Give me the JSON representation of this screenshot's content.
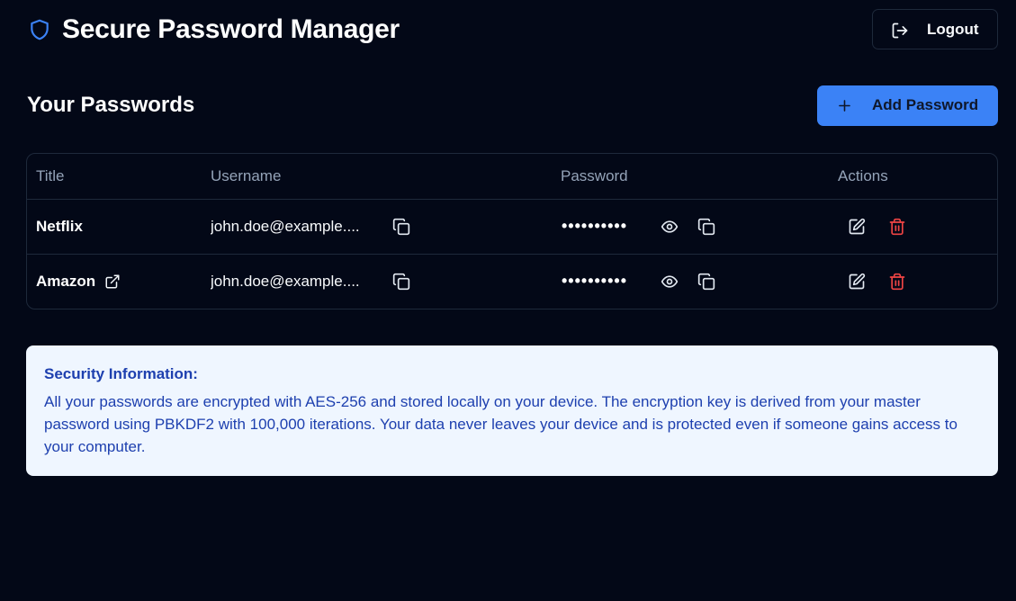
{
  "header": {
    "title": "Secure Password Manager",
    "logout_label": "Logout",
    "brand_icon": "shield-icon"
  },
  "section": {
    "title": "Your Passwords",
    "add_label": "Add Password"
  },
  "table": {
    "columns": [
      "Title",
      "Username",
      "Password",
      "Actions"
    ],
    "rows": [
      {
        "title": "Netflix",
        "username": "john.doe@example....",
        "password": "••••••••••",
        "has_link": false
      },
      {
        "title": "Amazon",
        "username": "john.doe@example....",
        "password": "••••••••••",
        "has_link": true
      }
    ]
  },
  "info": {
    "title": "Security Information:",
    "text": "All your passwords are encrypted with AES-256 and stored locally on your device. The encryption key is derived from your master password using PBKDF2 with 100,000 iterations. Your data never leaves your device and is protected even if someone gains access to your computer."
  },
  "colors": {
    "background": "#030817",
    "accent": "#3b82f6",
    "danger": "#ef4444",
    "info_bg": "#eff6ff",
    "info_text": "#1e40af"
  }
}
